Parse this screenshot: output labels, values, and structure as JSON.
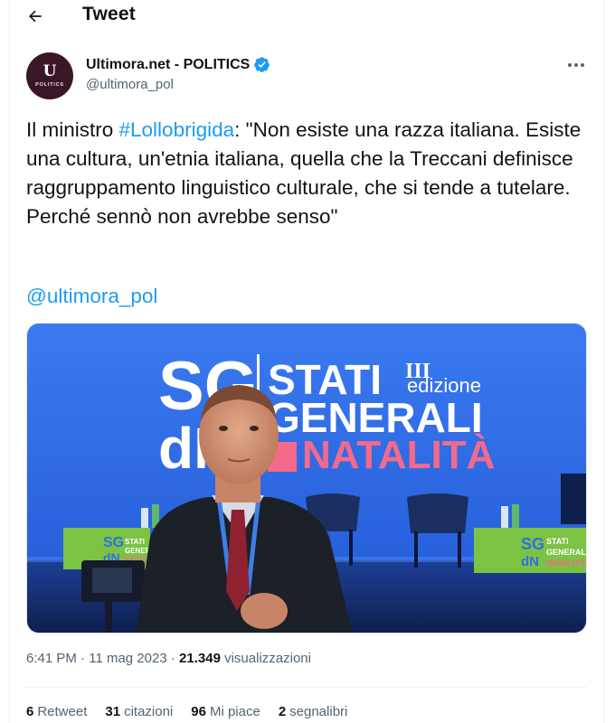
{
  "header": {
    "title": "Tweet"
  },
  "author": {
    "avatar_glyph": "U",
    "avatar_label": "POLITICS",
    "name": "Ultimora.net - POLITICS",
    "handle": "@ultimora_pol",
    "verified": true
  },
  "tweet": {
    "text_before": "Il ministro ",
    "hashtag": "#Lollobrigida",
    "text_after": ": \"Non esiste una razza italiana. Esiste una cultura, un'etnia italiana, quella che la Treccani definisce raggruppamento linguistico culturale, che si tende a tutelare. Perché sennò non avrebbe senso\"",
    "mention": "@ultimora_pol"
  },
  "media": {
    "sign_sg": "SG",
    "sign_dn": "dN",
    "sign_line1": "STATI",
    "sign_roman": "III",
    "sign_edizione": "edizione",
    "sign_line2": "GENERALI",
    "sign_line3": "NATALITÀ",
    "podium_sg": "SG",
    "podium_dn": "dN",
    "podium_stati": "STATI",
    "podium_generali": "GENERALI",
    "podium_natalita": "NATALITÀ",
    "colors": {
      "blue": "#2f6ee8",
      "pink": "#f36a8a",
      "green": "#7cc243"
    }
  },
  "meta": {
    "time": "6:41 PM",
    "sep1": " · ",
    "date": "11 mag 2023",
    "sep2": " · ",
    "views_count": "21.349",
    "views_label": "visualizzazioni"
  },
  "stats": [
    {
      "count": "6",
      "label": "Retweet"
    },
    {
      "count": "31",
      "label": "citazioni"
    },
    {
      "count": "96",
      "label": "Mi piace"
    },
    {
      "count": "2",
      "label": "segnalibri"
    }
  ],
  "colors": {
    "accent": "#1d9bf0",
    "muted": "#536471",
    "text": "#0f1419",
    "verified": "#1d9bf0"
  }
}
